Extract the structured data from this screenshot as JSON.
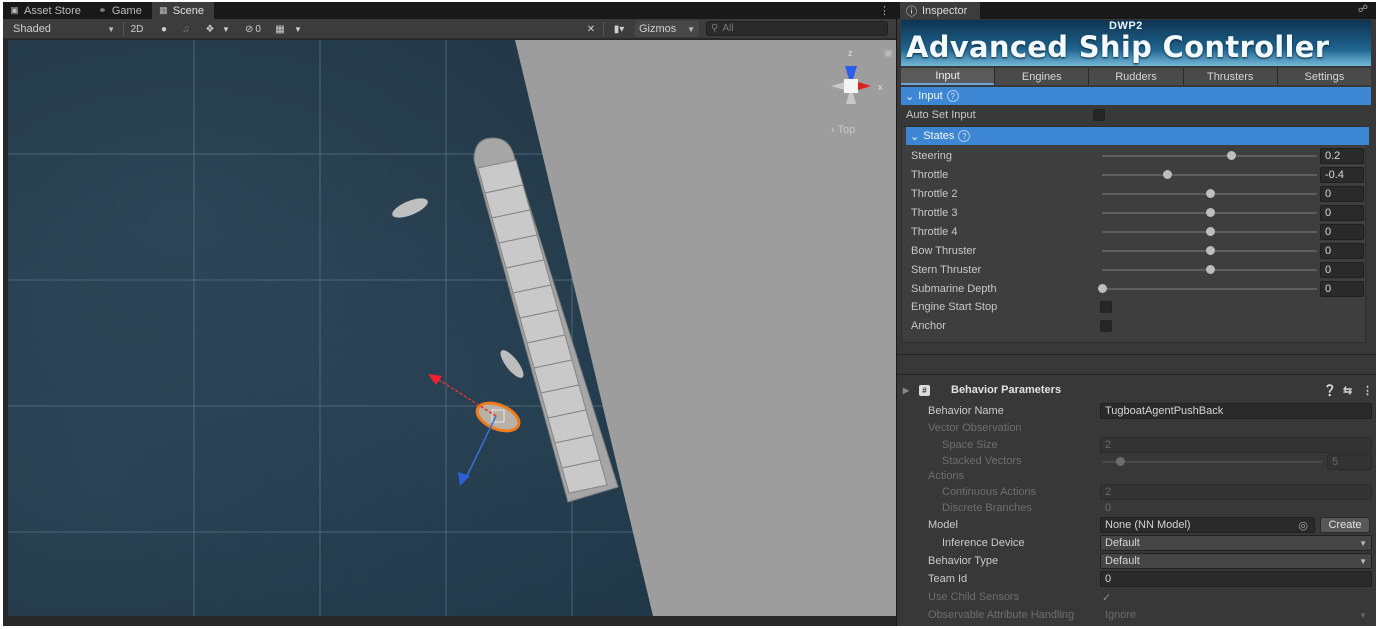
{
  "scene_window": {
    "tabs": [
      {
        "label": "Asset Store",
        "icon": "shopping-bag-icon"
      },
      {
        "label": "Game",
        "icon": "gamepad-icon"
      },
      {
        "label": "Scene",
        "icon": "grid-icon"
      }
    ],
    "toolbar": {
      "shading_mode": "Shaded",
      "toggle_2d": "2D",
      "hidden_count": "0",
      "gizmos_label": "Gizmos",
      "search_placeholder": "All"
    },
    "view_gizmo": {
      "axis_z": "z",
      "axis_x": "x",
      "view_label": "Top"
    }
  },
  "inspector": {
    "tab_label": "Inspector",
    "banner": {
      "subtitle": "DWP2",
      "title": "Advanced Ship Controller"
    },
    "component_tabs": [
      "Input",
      "Engines",
      "Rudders",
      "Thrusters",
      "Settings"
    ],
    "selected_component_tab": "Input",
    "input_section": {
      "header": "Input",
      "auto_set_input_label": "Auto Set Input",
      "auto_set_input_checked": false
    },
    "states_section": {
      "header": "States",
      "sliders": [
        {
          "label": "Steering",
          "value": "0.2",
          "fraction": 0.6
        },
        {
          "label": "Throttle",
          "value": "-0.4",
          "fraction": 0.3
        },
        {
          "label": "Throttle 2",
          "value": "0",
          "fraction": 0.5
        },
        {
          "label": "Throttle 3",
          "value": "0",
          "fraction": 0.5
        },
        {
          "label": "Throttle 4",
          "value": "0",
          "fraction": 0.5
        },
        {
          "label": "Bow Thruster",
          "value": "0",
          "fraction": 0.5
        },
        {
          "label": "Stern Thruster",
          "value": "0",
          "fraction": 0.5
        },
        {
          "label": "Submarine Depth",
          "value": "0",
          "fraction": 0.0
        }
      ],
      "toggles": [
        {
          "label": "Engine Start Stop",
          "checked": false
        },
        {
          "label": "Anchor",
          "checked": false
        }
      ]
    },
    "behavior_parameters": {
      "title": "Behavior Parameters",
      "behavior_name_label": "Behavior Name",
      "behavior_name_value": "TugboatAgentPushBack",
      "vector_observation_label": "Vector Observation",
      "space_size_label": "Space Size",
      "space_size_value": "2",
      "stacked_vectors_label": "Stacked Vectors",
      "stacked_vectors_value": "5",
      "stacked_vectors_fraction": 0.08,
      "actions_label": "Actions",
      "continuous_actions_label": "Continuous Actions",
      "continuous_actions_value": "2",
      "discrete_branches_label": "Discrete Branches",
      "discrete_branches_value": "0",
      "model_label": "Model",
      "model_value": "None (NN Model)",
      "create_button": "Create",
      "inference_device_label": "Inference Device",
      "inference_device_value": "Default",
      "behavior_type_label": "Behavior Type",
      "behavior_type_value": "Default",
      "team_id_label": "Team Id",
      "team_id_value": "0",
      "use_child_sensors_label": "Use Child Sensors",
      "use_child_sensors_checked": true,
      "observable_attr_label": "Observable Attribute Handling",
      "observable_attr_value": "Ignore"
    }
  }
}
